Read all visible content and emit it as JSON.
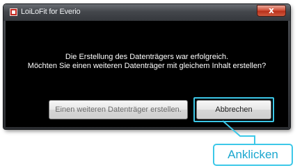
{
  "window": {
    "title": "LoiLoFit for Everio",
    "close_glyph": "x",
    "app_icon": "app-logo-icon"
  },
  "dialog": {
    "message_line1": "Die Erstellung des Datenträgers war erfolgreich.",
    "message_line2": "Möchten Sie einen weiteren Datenträger mit gleichem Inhalt erstellen?",
    "create_another_label": "Einen weiteren Datenträger erstellen.",
    "cancel_label": "Abbrechen"
  },
  "annotation": {
    "callout_label": "Anklicken",
    "accent_color": "#3cc8e8"
  }
}
